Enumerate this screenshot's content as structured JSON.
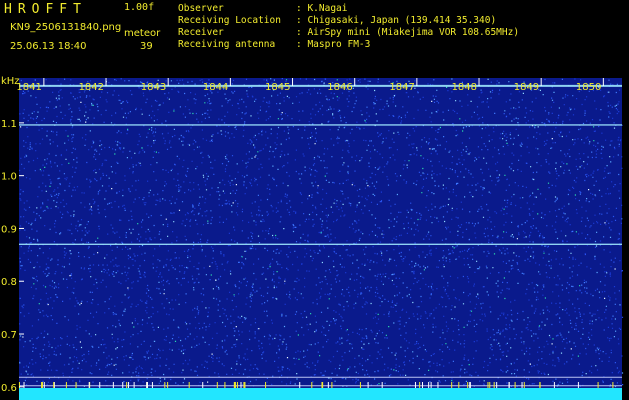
{
  "header": {
    "app_title": "HROFFT",
    "version": "1.00f",
    "filename": "KN9_2506131840.png",
    "datetime": "25.06.13 18:40",
    "meteor_label": "meteor",
    "meteor_count": "39",
    "info": [
      {
        "key": "Observer",
        "value": ": K.Nagai"
      },
      {
        "key": "Receiving Location",
        "value": ": Chigasaki, Japan (139.414 35.340)"
      },
      {
        "key": "Receiver",
        "value": ": AirSpy mini (Miakejima VOR 108.65MHz)"
      },
      {
        "key": "Receiving antenna",
        "value": ": Maspro FM-3"
      }
    ]
  },
  "colors": {
    "background": "#000000",
    "plot_background": "#0a1a8c",
    "label_yellow": "#f2ec2e",
    "text_white": "#ffffff",
    "signal_line": "#9ee8ff",
    "ground_band": "#22e6ff"
  },
  "chart_data": {
    "type": "heatmap",
    "y_unit_label": "kHz",
    "x_ticks": [
      "1841",
      "1842",
      "1843",
      "1844",
      "1845",
      "1846",
      "1847",
      "1848",
      "1849",
      "1850"
    ],
    "y_ticks": [
      "1.1",
      "1.0",
      "0.9",
      "0.8",
      "0.7",
      "0.6"
    ],
    "y_tick_values": [
      1.1,
      1.0,
      0.9,
      0.8,
      0.7,
      0.6
    ],
    "ylim": [
      0.575,
      1.185
    ],
    "xlim": [
      1840.6,
      1850.3
    ],
    "horizontal_signals_khz": [
      1.17,
      1.096,
      0.87,
      0.618,
      0.602
    ]
  }
}
